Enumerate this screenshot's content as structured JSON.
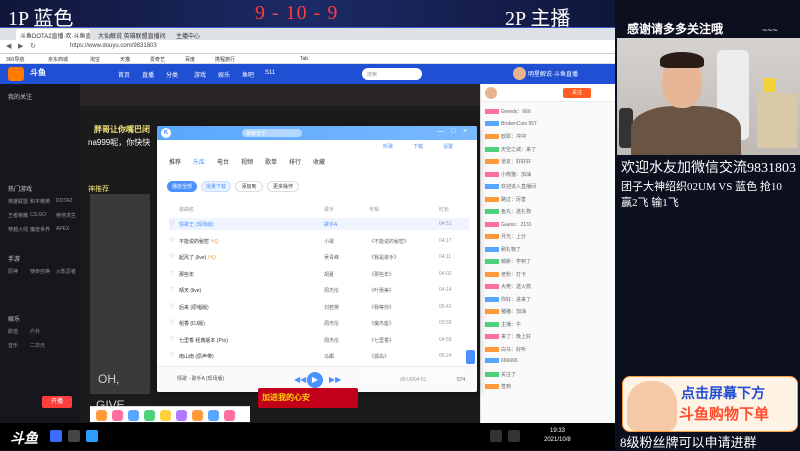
{
  "overlay": {
    "p1_label": "1P 蓝色",
    "score": "9 - 10 - 9",
    "p2_label": "2P 主播"
  },
  "browser": {
    "tabs": [
      "斗鱼DOTA2直播·欢·斗鱼直播",
      "大仙解说 英雄联盟直播间",
      "主播中心"
    ],
    "url": "https://www.douyu.com/9831803",
    "bookmarks": [
      "360导航",
      "京东商城",
      "淘宝",
      "天猫",
      "爱奇艺",
      "百度",
      "携程旅行",
      "Tab"
    ]
  },
  "douyu": {
    "logo": "斗鱼",
    "nav": [
      "首页",
      "直播",
      "分类",
      "游戏",
      "娱乐",
      "鱼吧",
      "S11"
    ],
    "search_placeholder": "搜索",
    "user": "明星解说·斗鱼直播"
  },
  "sidebar": {
    "sections": [
      {
        "title": "我的关注",
        "items": []
      },
      {
        "title": "热门游戏",
        "items": [
          "英雄联盟",
          "和平精英",
          "DOTA2",
          "王者荣耀",
          "CS:GO",
          "绝地求生",
          "穿越火线",
          "魔兽世界",
          "APEX"
        ]
      },
      {
        "title": "手游",
        "items": [
          "原神",
          "使命召唤",
          "火影忍者"
        ]
      },
      {
        "title": "娱乐",
        "items": [
          "颜值",
          "户外",
          "音乐",
          "二次元"
        ]
      }
    ],
    "bottom_button": "开播"
  },
  "video": {
    "text_a": "胖哥让你嘴巴闭",
    "text_b": "na999呢，你快快",
    "text_c": "OH,",
    "text_d": "GIVE",
    "text_e": "神推荐"
  },
  "chat": {
    "follow": "关注",
    "lines": [
      {
        "tag": "pink",
        "text": "Greedy：666"
      },
      {
        "tag": "blue",
        "text": "BrokenCoin 55T"
      },
      {
        "tag": "orange",
        "text": "欧耶：冲冲"
      },
      {
        "tag": "green",
        "text": "天空之城：来了"
      },
      {
        "tag": "orange",
        "text": "道友：好好好"
      },
      {
        "tag": "pink",
        "text": "小熊猫：加油"
      },
      {
        "tag": "blue",
        "text": "欢迎进入直播间"
      },
      {
        "tag": "orange",
        "text": "路过：厉害"
      },
      {
        "tag": "green",
        "text": "鱼丸：送礼物"
      },
      {
        "tag": "pink",
        "text": "Guess：2131"
      },
      {
        "tag": "orange",
        "text": "月光：上分"
      },
      {
        "tag": "blue",
        "text": "刷礼物了"
      },
      {
        "tag": "green",
        "text": "萌新：学到了"
      },
      {
        "tag": "orange",
        "text": "老粉：打卡"
      },
      {
        "tag": "pink",
        "text": "大佬：送火箭"
      },
      {
        "tag": "blue",
        "text": "你好：进来了"
      },
      {
        "tag": "orange",
        "text": "猪猪：加油"
      },
      {
        "tag": "green",
        "text": "主播：牛"
      },
      {
        "tag": "pink",
        "text": "来了：晚上好"
      },
      {
        "tag": "orange",
        "text": "白马：好听"
      },
      {
        "tag": "blue",
        "text": "666666"
      },
      {
        "tag": "green",
        "text": "关注了"
      },
      {
        "tag": "orange",
        "text": "签到"
      }
    ]
  },
  "music": {
    "logo": "K",
    "search": "搜索音乐",
    "window_btns": [
      "—",
      "□",
      "×"
    ],
    "side_tabs": [
      "听歌",
      "下载",
      "设置"
    ],
    "tabs": [
      "推荐",
      "乐库",
      "电台",
      "视频",
      "歌单",
      "排行",
      "收藏"
    ],
    "actions": {
      "play_all": "播放全部",
      "download": "批量下载",
      "add": "添加到",
      "more": "更多操作"
    },
    "columns": {
      "title": "歌曲名",
      "artist": "歌手",
      "album": "专辑",
      "duration": "时长"
    },
    "songs": [
      {
        "title": "情歌王 (现场版)",
        "artist": "歌手A",
        "album": "",
        "dur": "04:51",
        "hq": ""
      },
      {
        "title": "不能说的秘密",
        "artist": "小歌",
        "album": "《不能说的秘密》",
        "dur": "04:17",
        "hq": "HQ"
      },
      {
        "title": "起风了 (live)",
        "artist": "吴青峰",
        "album": "《我是歌手》",
        "dur": "04:11",
        "hq": "HQ"
      },
      {
        "title": "那些年",
        "artist": "胡夏",
        "album": "《那些年》",
        "dur": "04:02",
        "hq": ""
      },
      {
        "title": "晴天 (live)",
        "artist": "周杰伦",
        "album": "《叶惠美》",
        "dur": "04:14",
        "hq": ""
      },
      {
        "title": "后来 (原唱版)",
        "artist": "刘若英",
        "album": "《我等你》",
        "dur": "05:41",
        "hq": ""
      },
      {
        "title": "稻香 (DJ版)",
        "artist": "周杰伦",
        "album": "《魔杰座》",
        "dur": "03:59",
        "hq": ""
      },
      {
        "title": "七里香 经典版本 (Pro)",
        "artist": "周杰伦",
        "album": "《七里香》",
        "dur": "04:59",
        "hq": ""
      },
      {
        "title": "南山南 (原声带)",
        "artist": "马頔",
        "album": "《孤岛》",
        "dur": "05:24",
        "hq": ""
      }
    ],
    "now_playing": "情歌 - 歌手A (现场版)",
    "time": "00:00/04:51",
    "count": "574",
    "play": "▶",
    "prev": "◀◀",
    "next": "▶▶"
  },
  "bottom_overlay": {
    "banner": "加进我的心安",
    "ticker": "8级粉丝牌可以申请进群"
  },
  "taskbar": {
    "brand": "斗鱼",
    "time": "19:33",
    "date": "2021/10/8"
  },
  "right": {
    "thanks": "感谢请多多关注哦",
    "dots": "~~~",
    "line1": "欢迎水友加微信交流9831803",
    "line2": "团子大神绍织02UM VS 蓝色 抢10",
    "line3": "赢2飞  输1飞",
    "shop_top": "点击屏幕下方",
    "shop_bottom": "斗鱼购物下单",
    "bottom_text": "8级粉丝牌可以申请进群"
  }
}
